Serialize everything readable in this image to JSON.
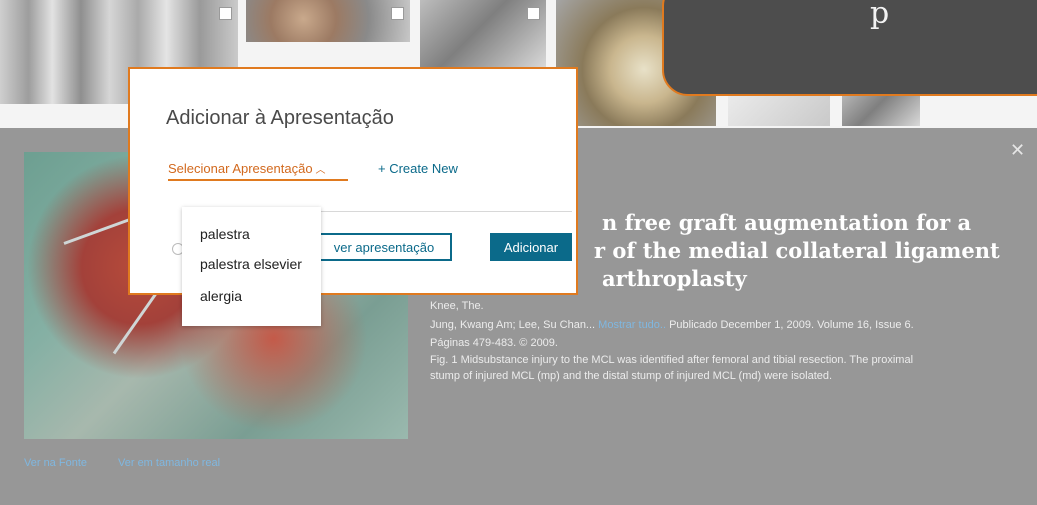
{
  "tooltip": {
    "text": "p"
  },
  "modal": {
    "title": "Adicionar à Apresentação",
    "select_label": "Selecionar Apresentação",
    "create_new": "+ Create New",
    "view_button": "ver apresentação",
    "add_button": "Adicionar"
  },
  "dropdown": {
    "options": [
      "palestra",
      "palestra elsevier",
      "alergia"
    ]
  },
  "article": {
    "title_line1": "n free graft augmentation for a",
    "title_line2": "r of the medial collateral ligament",
    "title_line3": "arthroplasty",
    "journal": "Knee, The.",
    "authors": "Jung, Kwang Am; Lee, Su Chan...",
    "show_all": "Mostrar tudo..",
    "published": "Publicado December 1, 2009. Volume 16, Issue 6.",
    "pages": "Páginas 479-483. © 2009.",
    "caption_line1": "Fig. 1 Midsubstance injury to the MCL was identified after femoral and tibial resection. The proximal",
    "caption_line2": "stump of injured MCL (mp) and the distal stump of injured MCL (md) were isolated."
  },
  "links": {
    "source": "Ver na Fonte",
    "full_size": "Ver em tamanho real"
  },
  "colors": {
    "accent_orange": "#e07a1f",
    "primary_blue": "#0b6a8a",
    "panel_gray": "#979797"
  }
}
